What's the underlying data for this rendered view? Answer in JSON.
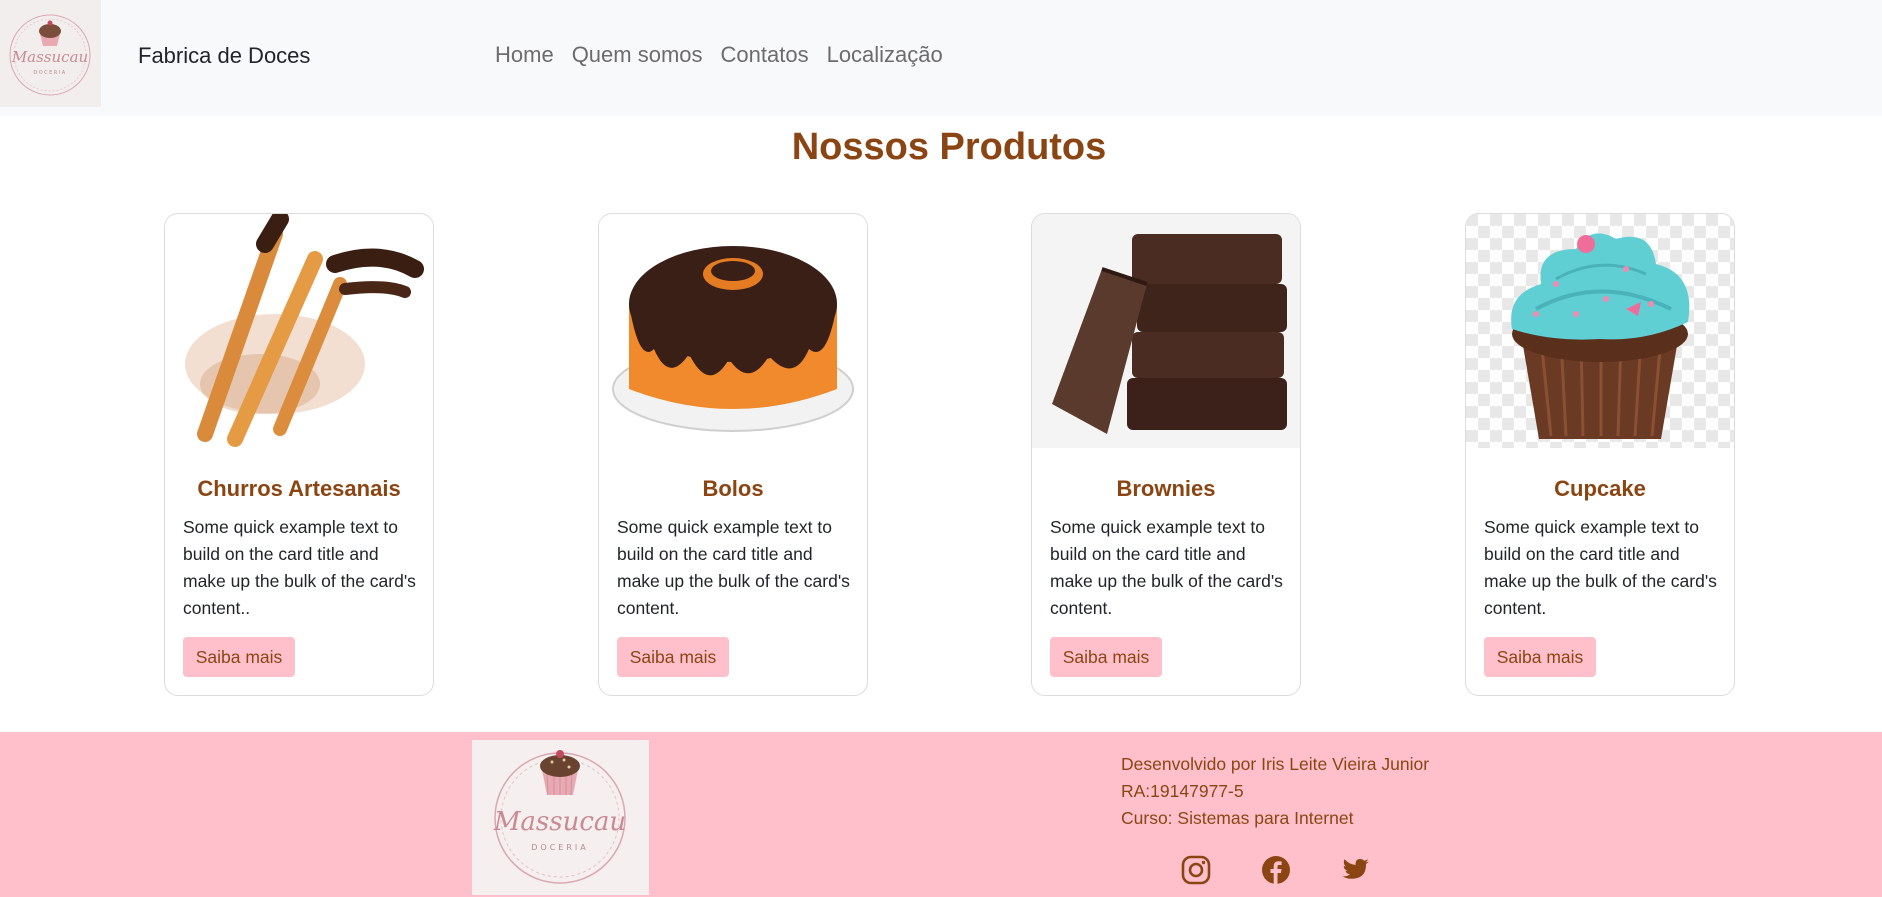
{
  "nav": {
    "logo_text": "Massucau",
    "logo_sub": "DOCERIA",
    "brand": "Fabrica de Doces",
    "links": [
      "Home",
      "Quem somos",
      "Contatos",
      "Localização"
    ]
  },
  "main": {
    "title": "Nossos Produtos",
    "cards": [
      {
        "title": "Churros Artesanais",
        "text": "Some quick example text to build on the card title and make up the bulk of the card's content..",
        "button": "Saiba mais",
        "image_icon": "churros-image"
      },
      {
        "title": "Bolos",
        "text": "Some quick example text to build on the card title and make up the bulk of the card's content.",
        "button": "Saiba mais",
        "image_icon": "cake-image"
      },
      {
        "title": "Brownies",
        "text": "Some quick example text to build on the card title and make up the bulk of the card's content.",
        "button": "Saiba mais",
        "image_icon": "brownies-image"
      },
      {
        "title": "Cupcake",
        "text": "Some quick example text to build on the card title and make up the bulk of the card's content.",
        "button": "Saiba mais",
        "image_icon": "cupcake-image"
      }
    ]
  },
  "footer": {
    "logo_text": "Massucau",
    "logo_sub": "DOCERIA",
    "developer": "Desenvolvido por Iris Leite Vieira Junior",
    "ra": "RA:19147977-5",
    "course": "Curso: Sistemas para Internet",
    "social": [
      "instagram-icon",
      "facebook-icon",
      "twitter-icon"
    ]
  },
  "colors": {
    "accent": "#8b4513",
    "pink": "#ffc0cb",
    "navbar_bg": "#f8f9fa"
  }
}
